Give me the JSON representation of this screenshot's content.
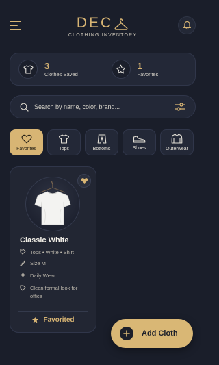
{
  "header": {
    "brand_title": "DEC",
    "brand_subtitle": "CLOTHING INVENTORY",
    "menu_icon": "hamburger-menu-icon",
    "logo_icon": "clothes-hanger-icon",
    "notification_icon": "bell-icon"
  },
  "stats": {
    "saved_count": "3",
    "saved_label": "Clothes Saved",
    "favorites_count": "1",
    "favorites_label": "Favorites"
  },
  "search": {
    "placeholder": "Search by name, color, brand...",
    "value": ""
  },
  "categories": [
    {
      "label": "Favorites",
      "icon": "heart-icon",
      "active": true
    },
    {
      "label": "Tops",
      "icon": "shirt-icon",
      "active": false
    },
    {
      "label": "Bottoms",
      "icon": "pants-icon",
      "active": false
    },
    {
      "label": "Shoes",
      "icon": "shoe-icon",
      "active": false
    },
    {
      "label": "Outerwear",
      "icon": "jacket-icon",
      "active": false
    }
  ],
  "item": {
    "name": "Classic White",
    "tags": "Tops • White • Shirt",
    "size": "Size M",
    "occasion": "Daily Wear",
    "note": "Clean formal look for office",
    "status": "Favorited",
    "favorite": true
  },
  "actions": {
    "add_label": "Add Cloth"
  },
  "colors": {
    "background": "#1a1e2a",
    "accent_gold": "#d8b574",
    "card": "#232837"
  }
}
